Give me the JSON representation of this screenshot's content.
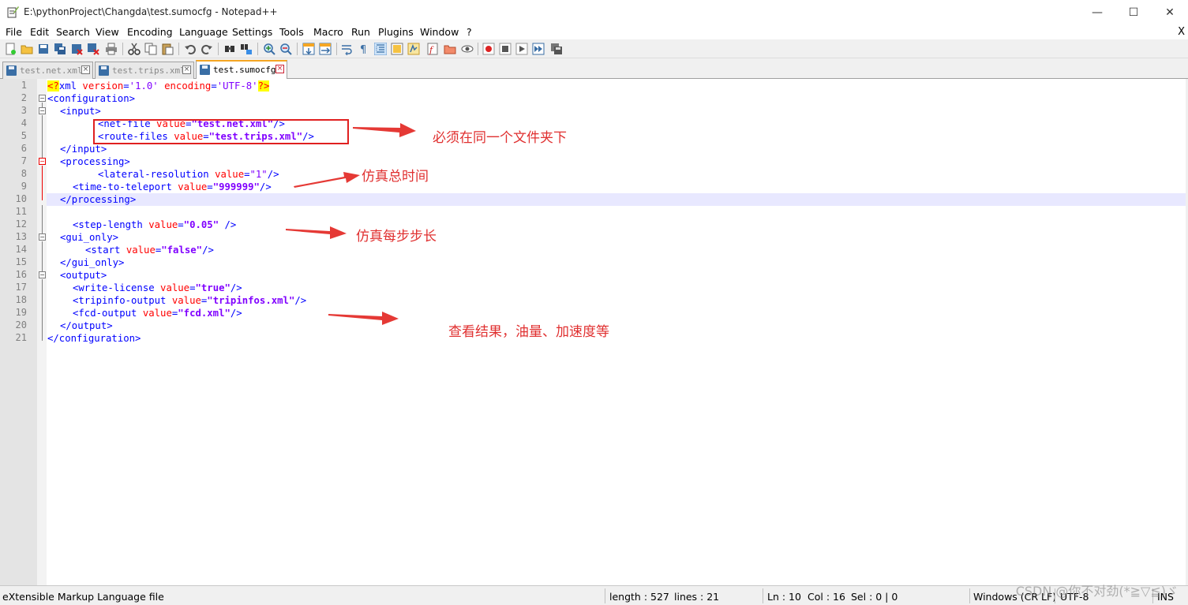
{
  "window": {
    "title": "E:\\pythonProject\\Changda\\test.sumocfg - Notepad++",
    "minimize_glyph": "—",
    "maximize_glyph": "☐",
    "close_glyph": "✕"
  },
  "menu": {
    "items": [
      "File",
      "Edit",
      "Search",
      "View",
      "Encoding",
      "Language",
      "Settings",
      "Tools",
      "Macro",
      "Run",
      "Plugins",
      "Window",
      "?"
    ],
    "close_label": "X"
  },
  "toolbar": {
    "icons": [
      "new-file-icon",
      "open-file-icon",
      "save-icon",
      "save-all-icon",
      "close-icon",
      "close-all-icon",
      "print-icon",
      "cut-icon",
      "copy-icon",
      "paste-icon",
      "undo-icon",
      "redo-icon",
      "find-icon",
      "replace-icon",
      "zoom-in-icon",
      "zoom-out-icon",
      "sync-vertical-icon",
      "sync-horizontal-icon",
      "word-wrap-icon",
      "show-all-chars-icon",
      "indent-guide-icon",
      "user-language-icon",
      "doc-map-icon",
      "function-list-icon",
      "folder-workspace-icon",
      "monitoring-icon",
      "record-macro-icon",
      "stop-macro-icon",
      "play-macro-icon",
      "run-macro-multiple-icon",
      "save-macro-icon"
    ]
  },
  "tabs": [
    {
      "label": "test.net.xml",
      "active": false
    },
    {
      "label": "test.trips.xml",
      "active": false
    },
    {
      "label": "test.sumocfg",
      "active": true
    }
  ],
  "editor": {
    "line_numbers": [
      "1",
      "2",
      "3",
      "4",
      "5",
      "6",
      "7",
      "8",
      "9",
      "10",
      "11",
      "12",
      "13",
      "14",
      "15",
      "16",
      "17",
      "18",
      "19",
      "20",
      "21"
    ],
    "lines": {
      "l1": {
        "pi_open": "<?",
        "tag": "xml",
        "a1": " version",
        "eq1": "=",
        "v1": "'1.0'",
        "a2": " encoding",
        "eq2": "=",
        "v2": "'UTF-8'",
        "pi_close": "?>"
      },
      "l2": {
        "tag": "<configuration>"
      },
      "l3": {
        "tag": "<input>"
      },
      "l4": {
        "open": "<net-file",
        "attr": " value",
        "eq": "=",
        "val": "\"test.net.xml\"",
        "close": "/>"
      },
      "l5": {
        "open": "<route-files",
        "attr": " value",
        "eq": "=",
        "val": "\"test.trips.xml\"",
        "close": "/>"
      },
      "l6": {
        "tag": "</input>"
      },
      "l7": {
        "tag": "<processing>"
      },
      "l8": {
        "open": "<lateral-resolution",
        "attr": " value",
        "eq": "=",
        "val": "\"1\"",
        "close": "/>"
      },
      "l9": {
        "open": "<time-to-teleport",
        "attr": " value",
        "eq": "=",
        "val": "\"999999\"",
        "close": "/>"
      },
      "l10": {
        "tag": "</processing>"
      },
      "l12": {
        "open": "<step-length",
        "attr": " value",
        "eq": "=",
        "val": "\"0.05\"",
        "close": " />"
      },
      "l13": {
        "tag": "<gui_only>"
      },
      "l14": {
        "open": "<start",
        "attr": " value",
        "eq": "=",
        "val": "\"false\"",
        "close": "/>"
      },
      "l15": {
        "tag": "</gui_only>"
      },
      "l16": {
        "tag": "<output>"
      },
      "l17": {
        "open": "<write-license",
        "attr": " value",
        "eq": "=",
        "val": "\"true\"",
        "close": "/>"
      },
      "l18": {
        "open": "<tripinfo-output",
        "attr": " value",
        "eq": "=",
        "val": "\"tripinfos.xml\"",
        "close": "/>"
      },
      "l19": {
        "open": "<fcd-output",
        "attr": " value",
        "eq": "=",
        "val": "\"fcd.xml\"",
        "close": "/>"
      },
      "l20": {
        "tag": "</output>"
      },
      "l21": {
        "tag": "</configuration>"
      }
    }
  },
  "annotations": {
    "same_folder": "必须在同一个文件夹下",
    "sim_time": "仿真总时间",
    "step_length": "仿真每步步长",
    "results": "查看结果，油量、加速度等"
  },
  "colors": {
    "annotation": "#e03030",
    "tag": "#0000ff",
    "attribute": "#ff0000",
    "value": "#8000ff"
  },
  "status": {
    "file_type": "eXtensible Markup Language file",
    "length": "length : 527",
    "lines": "lines : 21",
    "ln": "Ln : 10",
    "col": "Col : 16",
    "sel": "Sel : 0 | 0",
    "eol": "Windows (CR LF)",
    "encoding": "UTF-8",
    "mode": "INS"
  },
  "watermark": "CSDN @你不对劲(*≧▽≦)ゞ"
}
